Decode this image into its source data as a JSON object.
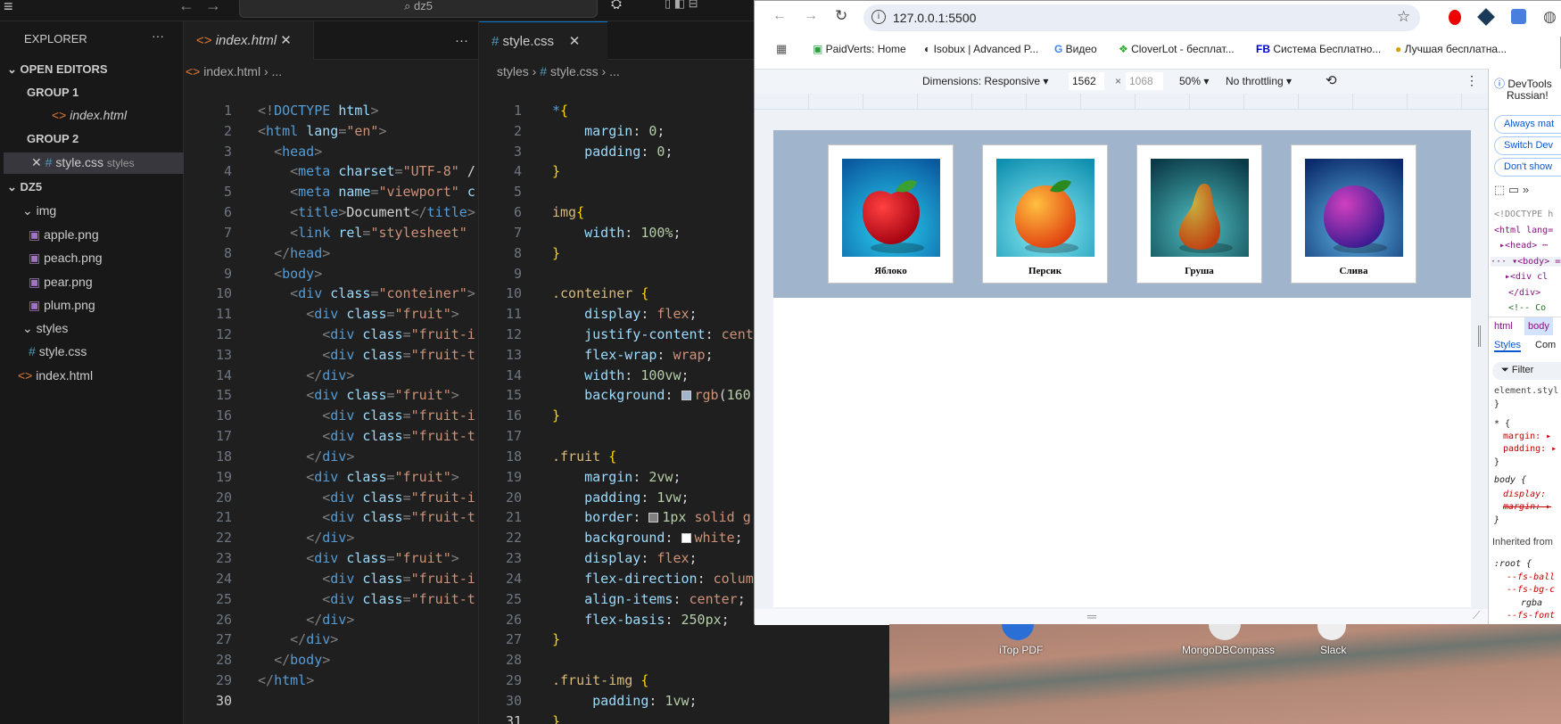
{
  "vscode": {
    "search": "dz5",
    "explorer": {
      "title": "EXPLORER",
      "more": "···",
      "open_editors": "OPEN EDITORS",
      "group1": "GROUP 1",
      "group1_file": "index.html",
      "group2": "GROUP 2",
      "group2_file": "style.css",
      "group2_hint": "styles",
      "folder": "DZ5",
      "img_folder": "img",
      "img_files": [
        "apple.png",
        "peach.png",
        "pear.png",
        "plum.png"
      ],
      "styles_folder": "styles",
      "styles_file": "style.css",
      "root_file": "index.html"
    },
    "html_editor": {
      "tab": "index.html",
      "more": "···",
      "breadcrumb_file": "index.html",
      "breadcrumb_rest": "...",
      "lines": [
        "<!DOCTYPE html>",
        "<html lang=\"en\">",
        "  <head>",
        "    <meta charset=\"UTF-8\" /",
        "    <meta name=\"viewport\" c",
        "    <title>Document</title>",
        "    <link rel=\"stylesheet\" ",
        "  </head>",
        "  <body>",
        "    <div class=\"conteiner\">",
        "      <div class=\"fruit\">",
        "        <div class=\"fruit-i",
        "        <div class=\"fruit-t",
        "      </div>",
        "      <div class=\"fruit\">",
        "        <div class=\"fruit-i",
        "        <div class=\"fruit-t",
        "      </div>",
        "      <div class=\"fruit\">",
        "        <div class=\"fruit-i",
        "        <div class=\"fruit-t",
        "      </div>",
        "      <div class=\"fruit\">",
        "        <div class=\"fruit-i",
        "        <div class=\"fruit-t",
        "      </div>",
        "    </div>",
        "  </body>",
        "</html>",
        ""
      ]
    },
    "css_editor": {
      "tab": "style.css",
      "breadcrumb_folder": "styles",
      "breadcrumb_file": "style.css",
      "breadcrumb_rest": "...",
      "lines": [
        "*{",
        "    margin: 0;",
        "    padding: 0;",
        "}",
        "",
        "img{",
        "    width: 100%;",
        "}",
        "",
        ".conteiner {",
        "    display: flex;",
        "    justify-content: cent",
        "    flex-wrap: wrap;",
        "    width: 100vw;",
        "    background: rgb(160",
        "}",
        "",
        ".fruit {",
        "    margin: 2vw;",
        "    padding: 1vw;",
        "    border: 1px solid g",
        "    background: white;",
        "    display: flex;",
        "    flex-direction: colum",
        "    align-items: center;",
        "    flex-basis: 250px;",
        "}",
        "",
        ".fruit-img {",
        "     padding: 1vw;",
        "}"
      ],
      "swatches": {
        "15": "#a0b4cc",
        "21": "#808080",
        "22": "#ffffff"
      }
    }
  },
  "browser": {
    "url": "127.0.0.1:5500",
    "bookmarks": [
      "PaidVerts: Home",
      "Isobux | Advanced P...",
      "Видео",
      "CloverLot - бесплат...",
      "Система Бесплатно...",
      "Лучшая бесплатна..."
    ],
    "device_toolbar": {
      "dimensions": "Dimensions: Responsive ▾",
      "width": "1562",
      "times": "×",
      "height": "1068",
      "zoom": "50% ▾",
      "throttling": "No throttling ▾"
    },
    "page": {
      "background": "#a0b4cc",
      "fruits": [
        {
          "name": "Яблоко",
          "icon": "apple"
        },
        {
          "name": "Персик",
          "icon": "peach"
        },
        {
          "name": "Груша",
          "icon": "pear"
        },
        {
          "name": "Слива",
          "icon": "plum"
        }
      ]
    },
    "devtools": {
      "banner": [
        "DevTools",
        "Russian!"
      ],
      "buttons": [
        "Always mat",
        "Switch Dev",
        "Don't show"
      ],
      "dom": [
        "<!DOCTYPE h",
        "<html lang=",
        "▸<head> ⋯",
        "··· ▾<body> ==",
        "▸<div cl",
        "</div>",
        "<!-- Co"
      ],
      "crumbs": [
        "html",
        "body"
      ],
      "tabs": [
        "Styles",
        "Com"
      ],
      "filter": "Filter",
      "styles": [
        "element.styl",
        "}",
        "* {",
        "margin: ▸",
        "padding: ▸",
        "}",
        "body {",
        "display:",
        "margin: ▸",
        "}"
      ],
      "inherited": "Inherited from",
      "root": [
        ":root {",
        "--fs-ball",
        "--fs-bg-c",
        "rgba",
        "--fs-font"
      ]
    }
  },
  "desktop": {
    "icons": [
      "iTop PDF",
      "MongoDBCompass",
      "Slack"
    ]
  }
}
